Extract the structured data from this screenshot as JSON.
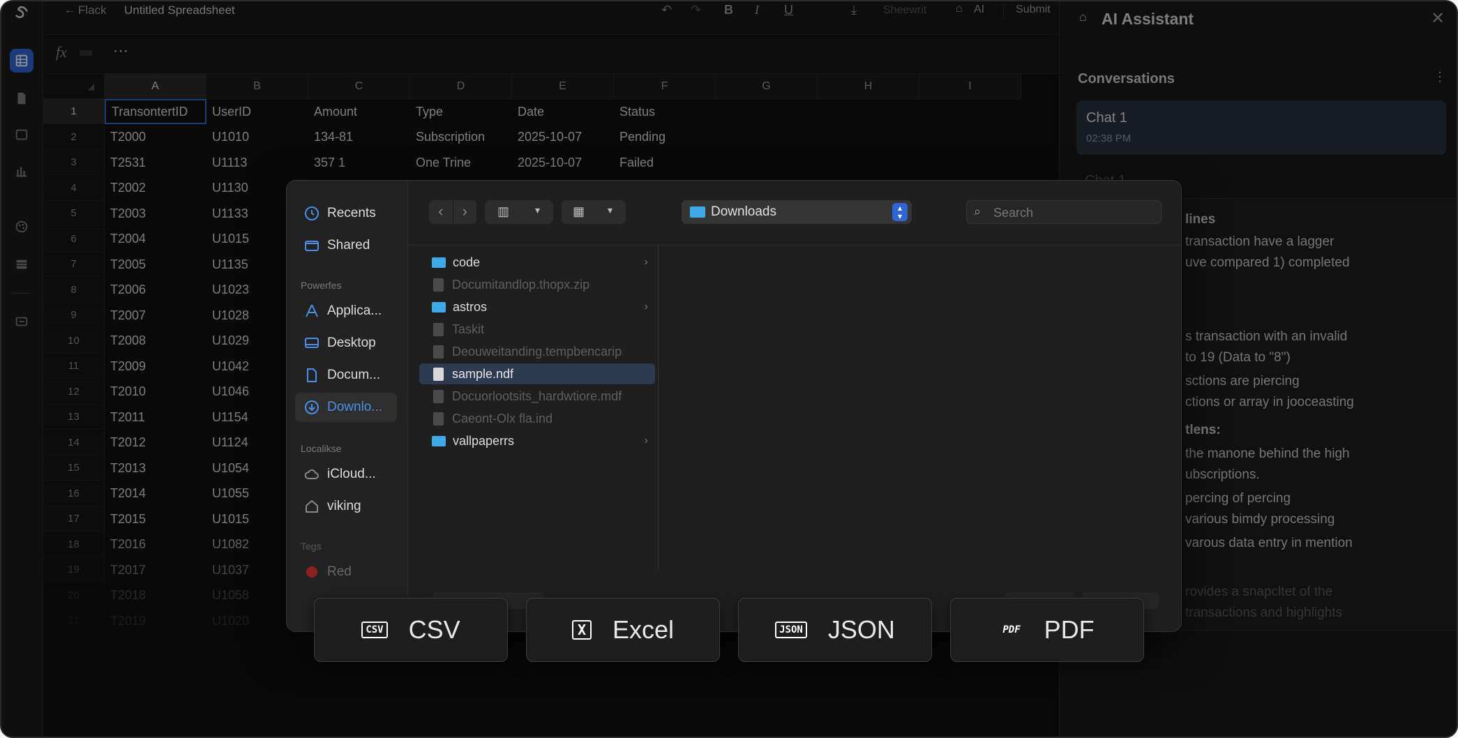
{
  "topbar": {
    "back_label": "Flack",
    "doc_title": "Untitled Spreadsheet",
    "bold": "B",
    "italic": "I",
    "underline": "U",
    "sheet_label": "Sheewrit",
    "ai_label": "AI",
    "submit_label": "Submit"
  },
  "formula": {
    "fx": "fx",
    "more": "⋯"
  },
  "grid": {
    "columns": [
      "A",
      "B",
      "C",
      "D",
      "E",
      "F",
      "G",
      "H",
      "I"
    ],
    "rows": [
      {
        "n": "1",
        "a": "TransontertID",
        "b": "UserID",
        "c": "Amount",
        "d": "Type",
        "e": "Date",
        "f": "Status"
      },
      {
        "n": "2",
        "a": "T2000",
        "b": "U1010",
        "c": "134-81",
        "d": "Subscription",
        "e": "2025-10-07",
        "f": "Pending"
      },
      {
        "n": "3",
        "a": "T2531",
        "b": "U1113",
        "c": "357 1",
        "d": "One Trine",
        "e": "2025-10-07",
        "f": "Failed"
      },
      {
        "n": "4",
        "a": "T2002",
        "b": "U1130"
      },
      {
        "n": "5",
        "a": "T2003",
        "b": "U1133"
      },
      {
        "n": "6",
        "a": "T2004",
        "b": "U1015"
      },
      {
        "n": "7",
        "a": "T2005",
        "b": "U1135"
      },
      {
        "n": "8",
        "a": "T2006",
        "b": "U1023"
      },
      {
        "n": "9",
        "a": "T2007",
        "b": "U1028"
      },
      {
        "n": "10",
        "a": "T2008",
        "b": "U1029"
      },
      {
        "n": "11",
        "a": "T2009",
        "b": "U1042"
      },
      {
        "n": "12",
        "a": "T2010",
        "b": "U1046"
      },
      {
        "n": "13",
        "a": "T2011",
        "b": "U1154"
      },
      {
        "n": "14",
        "a": "T2012",
        "b": "U1124"
      },
      {
        "n": "15",
        "a": "T2013",
        "b": "U1054"
      },
      {
        "n": "16",
        "a": "T2014",
        "b": "U1055"
      },
      {
        "n": "17",
        "a": "T2015",
        "b": "U1015"
      },
      {
        "n": "18",
        "a": "T2016",
        "b": "U1082"
      },
      {
        "n": "19",
        "a": "T2017",
        "b": "U1037"
      },
      {
        "n": "20",
        "a": "T2018",
        "b": "U1058"
      },
      {
        "n": "21",
        "a": "T2019",
        "b": "U1020"
      }
    ]
  },
  "ai": {
    "title": "AI Assistant",
    "conversations_label": "Conversations",
    "chat_title": "Chat 1",
    "chat_time": "02:38 PM",
    "chat2_partial": "Chat 1",
    "content_lines": [
      "lines",
      "transaction have a lagger",
      "uve compared 1) completed",
      "s transaction with an invalid",
      "to 19 (Data to \"8\")",
      "sctions are piercing",
      "ctions or array in jooceasting",
      "tlens:",
      "the manone behind the high",
      "ubscriptions.",
      "percing of percing",
      "various bimdy processing",
      "varous data entry in mention",
      "rovides a snapcltet of the",
      "transactions and highlights"
    ]
  },
  "dialog": {
    "location": "Downloads",
    "search_placeholder": "Search",
    "sidebar": {
      "recents": "Recents",
      "shared": "Shared",
      "favorites_label": "Powerfes",
      "applications": "Applica...",
      "desktop": "Desktop",
      "documents": "Docum...",
      "downloads": "Downlo...",
      "locations_label": "Localikse",
      "icloud": "iCloud...",
      "home": "viking",
      "tags_label": "Tegs",
      "red": "Red"
    },
    "files": [
      {
        "name": "code",
        "kind": "folder",
        "dim": false
      },
      {
        "name": "Documitandlop.thopx.zip",
        "kind": "file",
        "dim": true
      },
      {
        "name": "astros",
        "kind": "folder",
        "dim": false
      },
      {
        "name": "Taskit",
        "kind": "file",
        "dim": true
      },
      {
        "name": "Deouweitanding.tempbencarip",
        "kind": "file",
        "dim": true
      },
      {
        "name": "sample.ndf",
        "kind": "file",
        "dim": false
      },
      {
        "name": "Docuorlootsits_hardwtiore.mdf",
        "kind": "file",
        "dim": true
      },
      {
        "name": "Caeont-Olx fla.ind",
        "kind": "file",
        "dim": true
      },
      {
        "name": "vallpaperrs",
        "kind": "folder",
        "dim": false
      }
    ]
  },
  "export": {
    "csv": {
      "label": "CSV",
      "icon": "CSV"
    },
    "excel": {
      "label": "Excel",
      "icon": "X"
    },
    "json": {
      "label": "JSON",
      "icon": "JSON"
    },
    "pdf": {
      "label": "PDF",
      "icon": "PDF"
    }
  },
  "colors": {
    "accent": "#2f66d6",
    "selected_chat": "#2a3140",
    "folder": "#3fa8e6"
  }
}
